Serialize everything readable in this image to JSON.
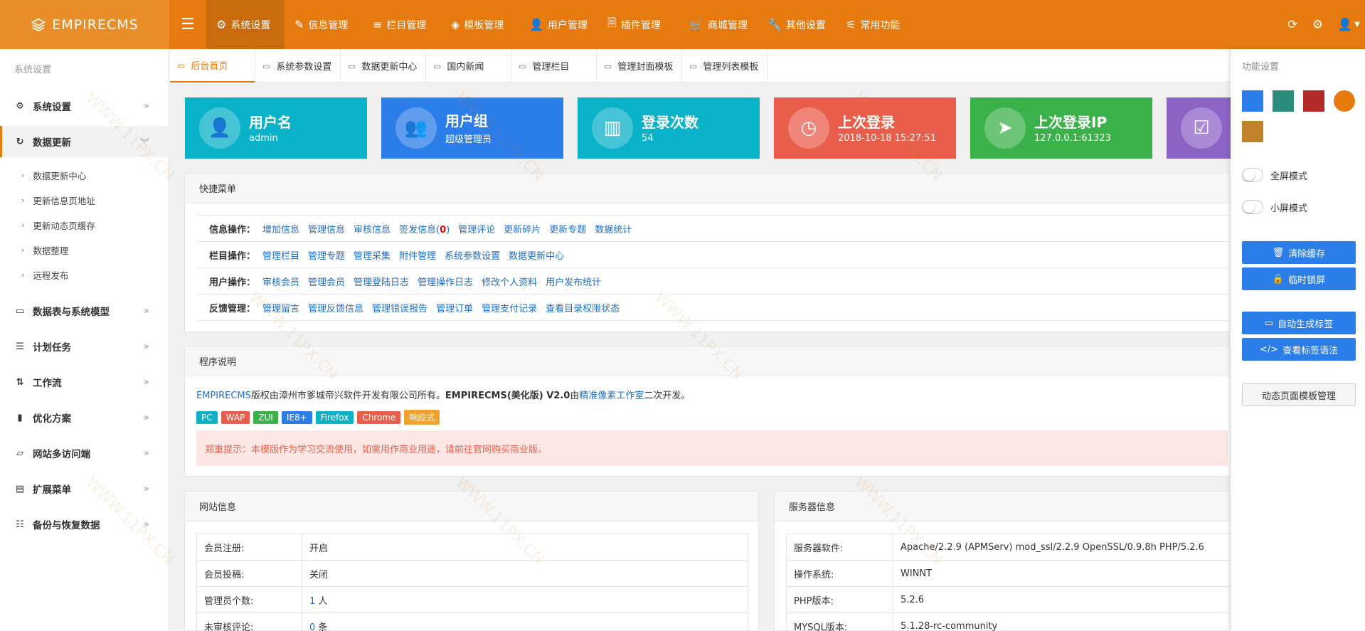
{
  "brand": {
    "logo_text": "EMPIRECMS"
  },
  "topnav": [
    {
      "label": "系统设置",
      "icon": "gear-icon"
    },
    {
      "label": "信息管理",
      "icon": "edit-icon"
    },
    {
      "label": "栏目管理",
      "icon": "list-icon"
    },
    {
      "label": "模板管理",
      "icon": "layers-icon"
    },
    {
      "label": "用户管理",
      "icon": "user-icon"
    },
    {
      "label": "插件管理",
      "icon": "file-code-icon"
    },
    {
      "label": "商城管理",
      "icon": "cart-icon"
    },
    {
      "label": "其他设置",
      "icon": "wrench-icon"
    },
    {
      "label": "常用功能",
      "icon": "sliders-icon"
    }
  ],
  "sidebar": {
    "title": "系统设置",
    "items": [
      {
        "label": "系统设置",
        "icon": "gear-icon"
      },
      {
        "label": "数据更新",
        "icon": "refresh-icon"
      },
      {
        "label": "数据表与系统模型",
        "icon": "hdd-icon"
      },
      {
        "label": "计划任务",
        "icon": "list-ol-icon"
      },
      {
        "label": "工作流",
        "icon": "sort-icon"
      },
      {
        "label": "优化方案",
        "icon": "book-icon"
      },
      {
        "label": "网站多访问端",
        "icon": "laptop-icon"
      },
      {
        "label": "扩展菜单",
        "icon": "list-alt-icon"
      },
      {
        "label": "备份与恢复数据",
        "icon": "database-icon"
      }
    ],
    "subitems": [
      "数据更新中心",
      "更新信息页地址",
      "更新动态页缓存",
      "数据整理",
      "远程发布"
    ]
  },
  "tabs": [
    "后台首页",
    "系统参数设置",
    "数据更新中心",
    "国内新闻",
    "管理栏目",
    "管理封面模板",
    "管理列表模板"
  ],
  "cards": [
    {
      "title": "用户名",
      "value": "admin",
      "color": "#09b1c9",
      "icon": "user-icon"
    },
    {
      "title": "用户组",
      "value": "超级管理员",
      "color": "#2b7de9",
      "icon": "users-icon"
    },
    {
      "title": "登录次数",
      "value": "54",
      "color": "#09b1c9",
      "icon": "chart-icon"
    },
    {
      "title": "上次登录",
      "value": "2018-10-18 15:27:51",
      "color": "#e95d4b",
      "icon": "clock-icon"
    },
    {
      "title": "上次登录IP",
      "value": "127.0.0.1:61323",
      "color": "#3bb14a",
      "icon": "location-arrow-icon"
    },
    {
      "title": "",
      "value": "",
      "color": "#8d63c6",
      "icon": "check-square-icon"
    }
  ],
  "quickmenu": {
    "title": "快捷菜单",
    "rows": [
      {
        "label": "信息操作：",
        "links": [
          "增加信息",
          "管理信息",
          "审核信息",
          "签发信息(0)",
          "管理评论",
          "更新碎片",
          "更新专题",
          "数据统计"
        ]
      },
      {
        "label": "栏目操作：",
        "links": [
          "管理栏目",
          "管理专题",
          "管理采集",
          "附件管理",
          "系统参数设置",
          "数据更新中心"
        ]
      },
      {
        "label": "用户操作：",
        "links": [
          "审核会员",
          "管理会员",
          "管理登陆日志",
          "管理操作日志",
          "修改个人资料",
          "用户发布统计"
        ]
      },
      {
        "label": "反馈管理：",
        "links": [
          "管理留言",
          "管理反馈信息",
          "管理错误报告",
          "管理订单",
          "管理支付记录",
          "查看目录权限状态"
        ]
      }
    ]
  },
  "program": {
    "title": "程序说明",
    "text_link1": "EMPIRECMS",
    "text1": "版权由漳州市爹城帝兴软件开发有限公司所有。",
    "text_bold": "EMPIRECMS(美化版) V2.0",
    "text2": "由",
    "text_link2": "精准像素工作室",
    "text3": "二次开发。",
    "badges": [
      {
        "label": "PC",
        "color": "#09b1c9"
      },
      {
        "label": "WAP",
        "color": "#e95d4b"
      },
      {
        "label": "ZUI",
        "color": "#3bb14a"
      },
      {
        "label": "IE8+",
        "color": "#2b7de9"
      },
      {
        "label": "Firefox",
        "color": "#09b1c9"
      },
      {
        "label": "Chrome",
        "color": "#e95d4b"
      },
      {
        "label": "响应式",
        "color": "#f0a22e"
      }
    ],
    "notice": "郑重提示：本模版作为学习交流使用，如需用作商业用途，请前往官网购买商业版。"
  },
  "siteinfo": {
    "title": "网站信息",
    "rows": [
      {
        "k": "会员注册:",
        "v": "开启"
      },
      {
        "k": "会员投稿:",
        "v": "关闭"
      },
      {
        "k": "管理员个数:",
        "v": "1",
        "unit": " 人"
      },
      {
        "k": "未审核评论:",
        "v": "0",
        "unit": " 条"
      }
    ]
  },
  "serverinfo": {
    "title": "服务器信息",
    "rows": [
      {
        "k": "服务器软件:",
        "v": "Apache/2.2.9 (APMServ) mod_ssl/2.2.9 OpenSSL/0.9.8h PHP/5.2.6"
      },
      {
        "k": "操作系统:",
        "v": "WINNT"
      },
      {
        "k": "PHP版本:",
        "v": "5.2.6"
      },
      {
        "k": "MYSQL版本:",
        "v": "5.1.28-rc-community"
      }
    ]
  },
  "rightpanel": {
    "title": "功能设置",
    "swatches": [
      "#2b7de9",
      "#2a8c7a",
      "#b32a2a",
      "#e77a0e",
      "#c0822a"
    ],
    "fullscreen": "全屏模式",
    "smallscreen": "小屏模式",
    "buttons": [
      "清除缓存",
      "临时锁屏",
      "自动生成标签",
      "查看标签语法"
    ],
    "plain_button": "动态页面模板管理"
  }
}
